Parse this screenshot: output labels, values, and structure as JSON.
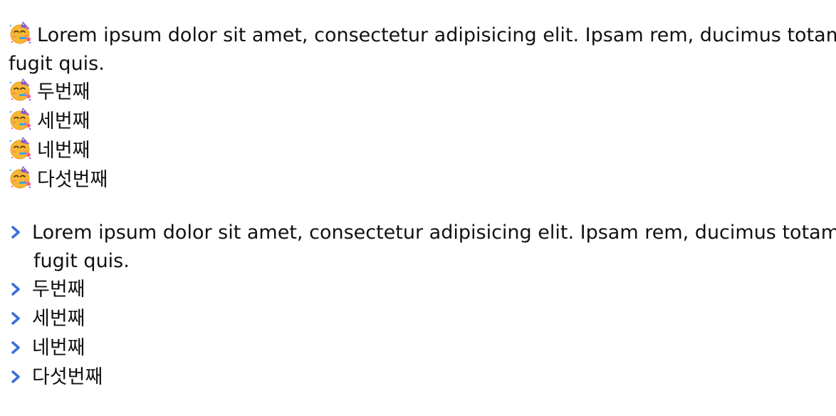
{
  "emoji_list": {
    "icon": "partying-face-emoji-icon",
    "items": [
      {
        "line1": "Lorem ipsum dolor sit amet, consectetur adipisicing elit. Ipsam rem, ducimus totam v",
        "line2": "fugit quis."
      },
      {
        "line1": "두번째"
      },
      {
        "line1": "세번째"
      },
      {
        "line1": "네번째"
      },
      {
        "line1": "다섯번째"
      }
    ]
  },
  "arrow_list": {
    "icon": "chevron-right-icon",
    "accent": "#3b6fd8",
    "items": [
      {
        "line1": "Lorem ipsum dolor sit amet, consectetur adipisicing elit. Ipsam rem, ducimus totam v",
        "line2": "fugit quis."
      },
      {
        "line1": "두번째"
      },
      {
        "line1": "세번째"
      },
      {
        "line1": "네번째"
      },
      {
        "line1": "다섯번째"
      }
    ]
  }
}
